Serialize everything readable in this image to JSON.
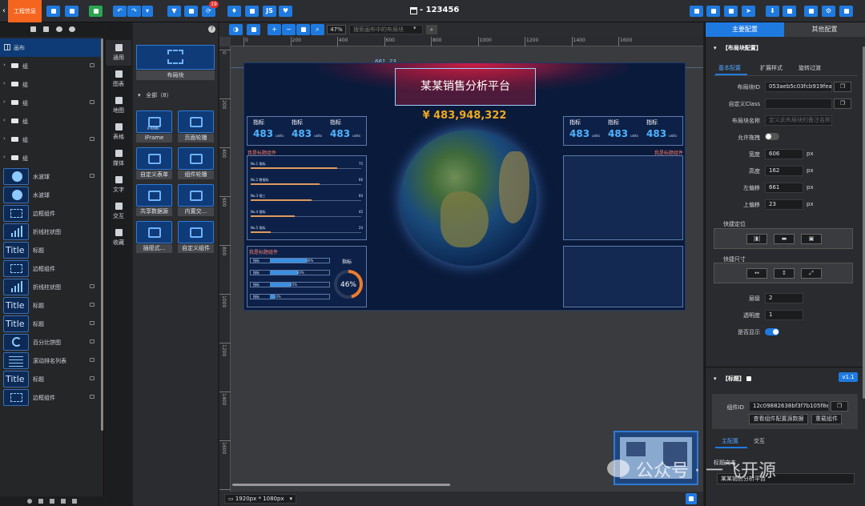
{
  "colors": {
    "accent": "#1f7ae0",
    "brand": "#f5651f",
    "gold": "#f0a91c",
    "danger": "#e03030"
  },
  "topbar": {
    "project_badge": "工程信息",
    "title": "123456",
    "notification_count": "19",
    "js_label": "JS"
  },
  "layers": {
    "items": [
      {
        "label": "画布",
        "icon": "grid-icon"
      },
      {
        "label": "组",
        "icon": "folder-icon",
        "locked": true
      },
      {
        "label": "组",
        "icon": "folder-icon",
        "locked": false
      },
      {
        "label": "组",
        "icon": "folder-icon",
        "locked": true
      },
      {
        "label": "组",
        "icon": "folder-icon",
        "locked": false
      },
      {
        "label": "组",
        "icon": "folder-icon",
        "locked": true
      },
      {
        "label": "组",
        "icon": "folder-icon",
        "locked": false
      },
      {
        "label": "水波球",
        "thumb": "ball",
        "locked": true
      },
      {
        "label": "水波球",
        "thumb": "ball",
        "locked": false
      },
      {
        "label": "边框组件",
        "thumb": "frame",
        "locked": false
      },
      {
        "label": "折线柱状图",
        "thumb": "bars",
        "locked": false
      },
      {
        "label": "标题",
        "thumb": "title",
        "locked": false
      },
      {
        "label": "边框组件",
        "thumb": "frame",
        "locked": false
      },
      {
        "label": "折线柱状图",
        "thumb": "bars",
        "locked": true
      },
      {
        "label": "标题",
        "thumb": "title",
        "locked": true
      },
      {
        "label": "标题",
        "thumb": "title",
        "locked": true
      },
      {
        "label": "百分比饼图",
        "thumb": "pie",
        "locked": true
      },
      {
        "label": "滚动排名列表",
        "thumb": "list",
        "locked": true
      },
      {
        "label": "标题",
        "thumb": "title",
        "locked": true
      },
      {
        "label": "边框组件",
        "thumb": "frame",
        "locked": true
      }
    ],
    "thumb_title_text": "Title"
  },
  "rail": {
    "items": [
      "通用",
      "图表",
      "地图",
      "表格",
      "媒体",
      "文字",
      "交互",
      "收藏"
    ]
  },
  "palette": {
    "layout_block": "布局块",
    "group_label": "全部（8）",
    "items": [
      "iFrame",
      "页面轮播",
      "自定义表单",
      "组件轮播",
      "共享数据源",
      "内置交...",
      "插屉式...",
      "自定义组件"
    ],
    "iframe_caption": "IFRAME"
  },
  "canvas": {
    "zoom": "47%",
    "search_placeholder": "搜索画布中的布局块",
    "ruler_h": [
      "0",
      "200",
      "400",
      "600",
      "800",
      "1000",
      "1200",
      "1400",
      "1600"
    ],
    "ruler_v": [
      "0",
      "200",
      "400",
      "600",
      "800",
      "1000",
      "1200",
      "1400",
      "1600",
      "1800"
    ],
    "coord": "661, 23",
    "size_select": "1920px * 1080px",
    "dashboard": {
      "title": "某某销售分析平台",
      "total": "¥ 483,948,322",
      "kpi_label": "指标",
      "kpi_value": "483",
      "kpi_unit": "units",
      "placeholder_title": "我是标题组件",
      "rank_rows": [
        {
          "name": "No.1  指标",
          "value": "75",
          "pct": 0.78
        },
        {
          "name": "No.2  数指标",
          "value": "66",
          "pct": 0.62
        },
        {
          "name": "No.3  指三",
          "value": "60",
          "pct": 0.55
        },
        {
          "name": "No.4  指标",
          "value": "45",
          "pct": 0.4
        },
        {
          "name": "No.5  指标",
          "value": "20",
          "pct": 0.18
        }
      ],
      "prog_rows": [
        {
          "label": "指标",
          "pct": 0.8,
          "text": "80%"
        },
        {
          "label": "指标",
          "pct": 0.6,
          "text": "60%"
        },
        {
          "label": "指标",
          "pct": 0.45,
          "text": "45%"
        },
        {
          "label": "指标",
          "pct": 0.1,
          "text": "10%"
        }
      ],
      "ring_label": "指标",
      "ring_value": "46%"
    }
  },
  "config": {
    "tabs": [
      "主要配置",
      "其他配置"
    ],
    "section1_title": "【布局块配置】",
    "subtabs": [
      "基本配置",
      "扩展样式",
      "旋转过渡"
    ],
    "fields": [
      {
        "label": "布局块ID",
        "value": "053aeb5c03fcb919fea"
      },
      {
        "label": "自定义Class",
        "value": ""
      },
      {
        "label": "布局块名称",
        "placeholder": "定义此布局块的备注名称"
      },
      {
        "label": "允许拖拽"
      },
      {
        "label": "宽度",
        "value": "606",
        "unit": "px"
      },
      {
        "label": "高度",
        "value": "162",
        "unit": "px"
      },
      {
        "label": "左偏移",
        "value": "661",
        "unit": "px"
      },
      {
        "label": "上偏移",
        "value": "23",
        "unit": "px"
      }
    ],
    "quick_position": "快捷定位",
    "quick_size": "快捷尺寸",
    "layer_label": "层级",
    "layer_value": "2",
    "opacity_label": "透明度",
    "opacity_value": "1",
    "visible_label": "是否显示",
    "section2_title": "【标题】",
    "version": "v1.1",
    "component_id_label": "组件ID",
    "component_id": "12c09882638bf3f7b105f8ec",
    "view_source_button": "查看组件配置源数据",
    "reset_button": "重载组件",
    "subtabs2": [
      "主配置",
      "交互"
    ],
    "title_text_label": "标题文本",
    "title_text_value": "某某销售分析平台"
  },
  "watermark": "公众号 · 一飞开源"
}
